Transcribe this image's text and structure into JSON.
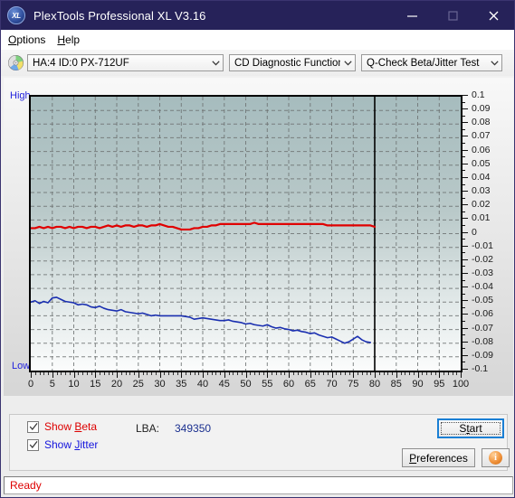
{
  "window": {
    "title": "PlexTools Professional XL V3.16",
    "logo_text": "XL",
    "minimize_icon": "minimize-icon",
    "maximize_icon": "maximize-icon",
    "close_icon": "close-icon"
  },
  "menu": {
    "items": [
      {
        "label": "Options",
        "accel": "O"
      },
      {
        "label": "Help",
        "accel": "H"
      }
    ]
  },
  "toolbar": {
    "disc_icon": "cd-disc-icon",
    "drive_combo": {
      "value": "HA:4 ID:0  PX-712UF",
      "chevron_icon": "chevron-down-icon"
    },
    "function_combo": {
      "value": "CD Diagnostic Functions",
      "chevron_icon": "chevron-down-icon"
    },
    "test_combo": {
      "value": "Q-Check Beta/Jitter Test",
      "chevron_icon": "chevron-down-icon"
    }
  },
  "controls": {
    "show_beta": {
      "label_pre": "Show ",
      "label_accel": "B",
      "label_post": "eta",
      "checked": true,
      "color": "#dd0000"
    },
    "show_jitter": {
      "label_pre": "Show ",
      "label_accel": "J",
      "label_post": "itter",
      "checked": true,
      "color": "#1414dd"
    },
    "lba_label": "LBA:",
    "lba_value": "349350",
    "start_button": {
      "label_pre": "S",
      "label_accel": "t",
      "label_post": "art",
      "full": "Start"
    },
    "preferences_button": {
      "label_accel": "P",
      "label_post": "references",
      "full": "Preferences"
    },
    "info_button": {
      "glyph": "i",
      "name": "info-icon"
    }
  },
  "status": {
    "text": "Ready"
  },
  "chart_data": {
    "type": "line",
    "title": "",
    "xlabel": "",
    "ylabel": "",
    "y_axis_top_label": "High",
    "y_axis_bottom_label": "Low",
    "xlim": [
      0,
      100
    ],
    "ylim": [
      -0.1,
      0.1
    ],
    "xticks": [
      0,
      5,
      10,
      15,
      20,
      25,
      30,
      35,
      40,
      45,
      50,
      55,
      60,
      65,
      70,
      75,
      80,
      85,
      90,
      95,
      100
    ],
    "yticks": [
      0.1,
      0.09,
      0.08,
      0.07,
      0.06,
      0.05,
      0.04,
      0.03,
      0.02,
      0.01,
      0,
      -0.01,
      -0.02,
      -0.03,
      -0.04,
      -0.05,
      -0.06,
      -0.07,
      -0.08,
      -0.09,
      -0.1
    ],
    "grid": true,
    "grid_style": "dashed",
    "grid_color": "#6e7373",
    "plot_bg_top": "#a6bcbe",
    "plot_bg_bottom": "#fbfcfc",
    "marker_line_x": 80,
    "marker_line_color": "#000000",
    "legend": "none",
    "series": [
      {
        "name": "Beta",
        "color": "#e00000",
        "x": [
          0,
          1,
          2,
          3,
          4,
          5,
          6,
          7,
          8,
          9,
          10,
          11,
          12,
          13,
          14,
          15,
          16,
          17,
          18,
          19,
          20,
          21,
          22,
          23,
          24,
          25,
          26,
          27,
          28,
          29,
          30,
          31,
          32,
          33,
          34,
          35,
          36,
          37,
          38,
          39,
          40,
          41,
          42,
          43,
          44,
          45,
          46,
          47,
          48,
          49,
          50,
          51,
          52,
          53,
          54,
          55,
          56,
          57,
          58,
          59,
          60,
          61,
          62,
          63,
          64,
          65,
          66,
          67,
          68,
          69,
          70,
          71,
          72,
          73,
          74,
          75,
          76,
          77,
          78,
          79,
          80
        ],
        "values": [
          0.004,
          0.004,
          0.005,
          0.004,
          0.005,
          0.004,
          0.005,
          0.005,
          0.004,
          0.005,
          0.004,
          0.005,
          0.005,
          0.004,
          0.005,
          0.005,
          0.004,
          0.005,
          0.006,
          0.005,
          0.006,
          0.005,
          0.006,
          0.006,
          0.005,
          0.006,
          0.006,
          0.005,
          0.006,
          0.006,
          0.007,
          0.006,
          0.005,
          0.005,
          0.004,
          0.003,
          0.003,
          0.003,
          0.004,
          0.004,
          0.005,
          0.005,
          0.006,
          0.006,
          0.007,
          0.007,
          0.007,
          0.007,
          0.007,
          0.007,
          0.007,
          0.007,
          0.008,
          0.007,
          0.007,
          0.007,
          0.007,
          0.007,
          0.007,
          0.007,
          0.007,
          0.007,
          0.007,
          0.007,
          0.007,
          0.007,
          0.007,
          0.007,
          0.007,
          0.006,
          0.006,
          0.006,
          0.006,
          0.006,
          0.006,
          0.006,
          0.006,
          0.006,
          0.006,
          0.006,
          0.005
        ]
      },
      {
        "name": "Jitter",
        "color": "#1a2fb0",
        "x": [
          0,
          1,
          2,
          3,
          4,
          5,
          6,
          7,
          8,
          9,
          10,
          11,
          12,
          13,
          14,
          15,
          16,
          17,
          18,
          19,
          20,
          21,
          22,
          23,
          24,
          25,
          26,
          27,
          28,
          29,
          30,
          31,
          32,
          33,
          34,
          35,
          36,
          37,
          38,
          39,
          40,
          41,
          42,
          43,
          44,
          45,
          46,
          47,
          48,
          49,
          50,
          51,
          52,
          53,
          54,
          55,
          56,
          57,
          58,
          59,
          60,
          61,
          62,
          63,
          64,
          65,
          66,
          67,
          68,
          69,
          70,
          71,
          72,
          73,
          74,
          75,
          76,
          77,
          78,
          79
        ],
        "values": [
          -0.05,
          -0.049,
          -0.051,
          -0.0495,
          -0.0505,
          -0.047,
          -0.0465,
          -0.048,
          -0.0495,
          -0.05,
          -0.0505,
          -0.052,
          -0.0515,
          -0.052,
          -0.0535,
          -0.054,
          -0.053,
          -0.0545,
          -0.0555,
          -0.056,
          -0.0565,
          -0.0555,
          -0.057,
          -0.0575,
          -0.058,
          -0.0585,
          -0.058,
          -0.059,
          -0.06,
          -0.0595,
          -0.06,
          -0.06,
          -0.06,
          -0.06,
          -0.06,
          -0.06,
          -0.0605,
          -0.061,
          -0.0625,
          -0.062,
          -0.0615,
          -0.062,
          -0.0625,
          -0.063,
          -0.0635,
          -0.0635,
          -0.063,
          -0.064,
          -0.0645,
          -0.065,
          -0.066,
          -0.0655,
          -0.0665,
          -0.067,
          -0.0675,
          -0.0665,
          -0.068,
          -0.069,
          -0.0685,
          -0.0695,
          -0.07,
          -0.071,
          -0.0705,
          -0.0715,
          -0.072,
          -0.073,
          -0.0725,
          -0.074,
          -0.075,
          -0.076,
          -0.0755,
          -0.077,
          -0.0785,
          -0.08,
          -0.079,
          -0.077,
          -0.075,
          -0.0775,
          -0.079,
          -0.0795
        ]
      }
    ]
  }
}
